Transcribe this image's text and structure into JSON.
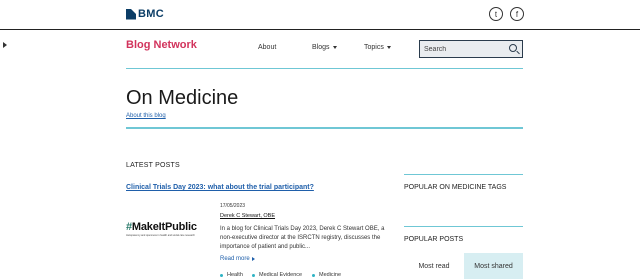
{
  "brand": {
    "name": "BMC",
    "color": "#0b3d66"
  },
  "social": [
    {
      "name": "twitter",
      "glyph": "t"
    },
    {
      "name": "facebook",
      "glyph": "f"
    }
  ],
  "header": {
    "blog_network": "Blog Network",
    "nav": [
      {
        "label": "About"
      },
      {
        "label": "Blogs"
      },
      {
        "label": "Topics"
      }
    ],
    "search_placeholder": "Search"
  },
  "page": {
    "title": "On Medicine",
    "about_link": "About this blog"
  },
  "latest": {
    "heading": "LATEST POSTS",
    "post": {
      "title": "Clinical Trials Day 2023: what about the trial participant?",
      "date": "17/05/2023",
      "author": "Derek C Stewart, OBE",
      "excerpt": "In a blog for Clinical Trials Day 2023, Derek C Stewart OBE, a non-executive director at the ISRCTN registry, discusses the importance of patient and public...",
      "read_more": "Read more",
      "image": {
        "title_mark": "#",
        "title_text": "MakeItPublic",
        "subtitle": "transparency and openness in health and social care research"
      },
      "tags": [
        "Health",
        "Medical Evidence",
        "Medicine"
      ]
    }
  },
  "sidebar": {
    "popular_tags_heading": "POPULAR ON MEDICINE TAGS",
    "popular_posts_heading": "POPULAR POSTS",
    "tabs": [
      {
        "label": "Most read"
      },
      {
        "label": "Most shared"
      }
    ]
  },
  "colors": {
    "accent_pink": "#d2335c",
    "link_blue": "#1f5faa",
    "teal": "#6fc7d5",
    "tab_active_bg": "#d7eef2"
  }
}
